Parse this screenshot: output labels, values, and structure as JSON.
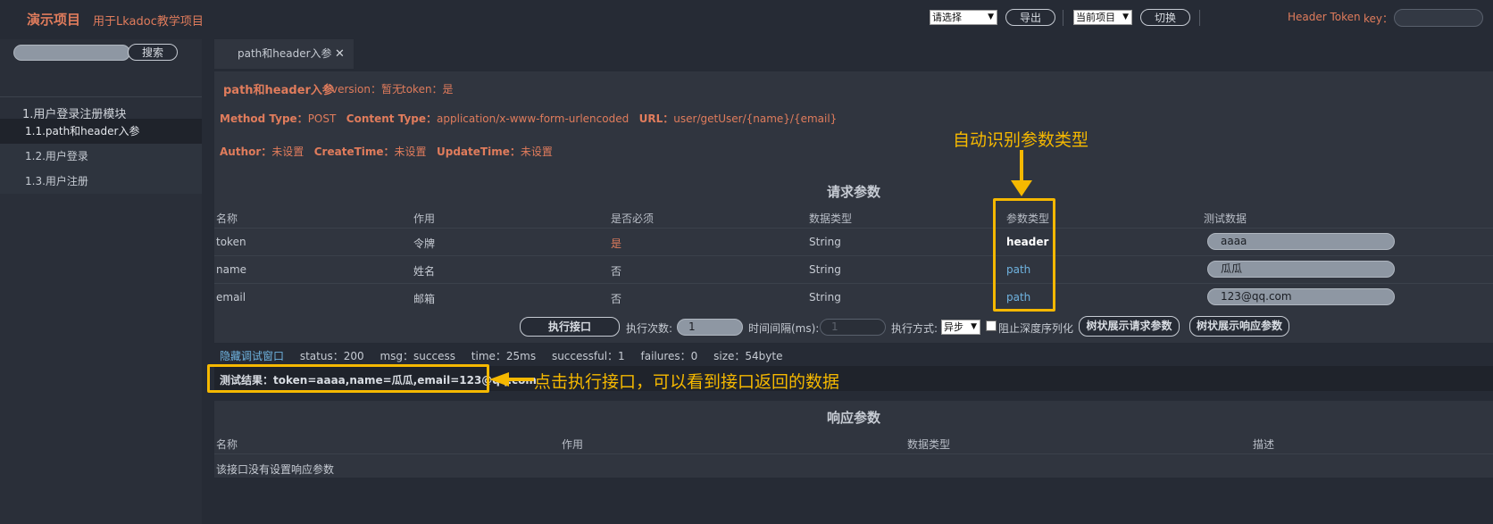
{
  "header": {
    "title": "演示项目",
    "subtitle": "用于Lkadoc教学项目",
    "select_placeholder": "请选择",
    "export_label": "导出",
    "project_select": "当前项目",
    "switch_label": "切换",
    "header_token_label": "Header Token",
    "key_label": "key："
  },
  "sidebar": {
    "search_label": "搜索",
    "group_title": "1.用户登录注册模块",
    "items": [
      {
        "label": "1.1.path和header入参",
        "active": true
      },
      {
        "label": "1.2.用户登录",
        "active": false
      },
      {
        "label": "1.3.用户注册",
        "active": false
      }
    ]
  },
  "tab": {
    "label": "path和header入参",
    "close": "✕"
  },
  "api": {
    "name": "path和header入参",
    "version": "version：暂无",
    "token": "token：是",
    "method_label": "Method Type：",
    "method": "POST",
    "content_label": "Content Type：",
    "content": "application/x-www-form-urlencoded",
    "url_label": "URL：",
    "url": "user/getUser/{name}/{email}",
    "author_label": "Author：",
    "author": "未设置",
    "create_label": "CreateTime：",
    "create": "未设置",
    "update_label": "UpdateTime：",
    "update": "未设置"
  },
  "request": {
    "title": "请求参数",
    "headers": [
      "名称",
      "作用",
      "是否必须",
      "数据类型",
      "参数类型",
      "测试数据"
    ],
    "rows": [
      {
        "name": "token",
        "desc": "令牌",
        "required": "是",
        "type": "String",
        "ptype": "header",
        "test": "aaaa"
      },
      {
        "name": "name",
        "desc": "姓名",
        "required": "否",
        "type": "String",
        "ptype": "path",
        "test": "瓜瓜"
      },
      {
        "name": "email",
        "desc": "邮箱",
        "required": "否",
        "type": "String",
        "ptype": "path",
        "test": "123@qq.com"
      }
    ]
  },
  "controls": {
    "execute_label": "执行接口",
    "count_label": "执行次数:",
    "count_value": "1",
    "interval_label": "时间间隔(ms):",
    "interval_placeholder": "1",
    "mode_label": "执行方式:",
    "mode_value": "异步",
    "block_label": "阻止深度序列化",
    "tree_request": "树状展示请求参数",
    "tree_response": "树状展示响应参数"
  },
  "status": {
    "toggle": "隐藏调试窗口",
    "status": "status：200",
    "msg": "msg：success",
    "time": "time：25ms",
    "successful": "successful：1",
    "failures": "failures：0",
    "size": "size：54byte"
  },
  "result": {
    "text": "测试结果：token=aaaa,name=瓜瓜,email=123@qq.com"
  },
  "response": {
    "title": "响应参数",
    "headers": [
      "名称",
      "作用",
      "数据类型",
      "描述"
    ],
    "empty": "该接口没有设置响应参数"
  },
  "annotations": {
    "auto_detect": "自动识别参数类型",
    "click_execute": "点击执行接口，可以看到接口返回的数据",
    "color": "#f5b800"
  }
}
